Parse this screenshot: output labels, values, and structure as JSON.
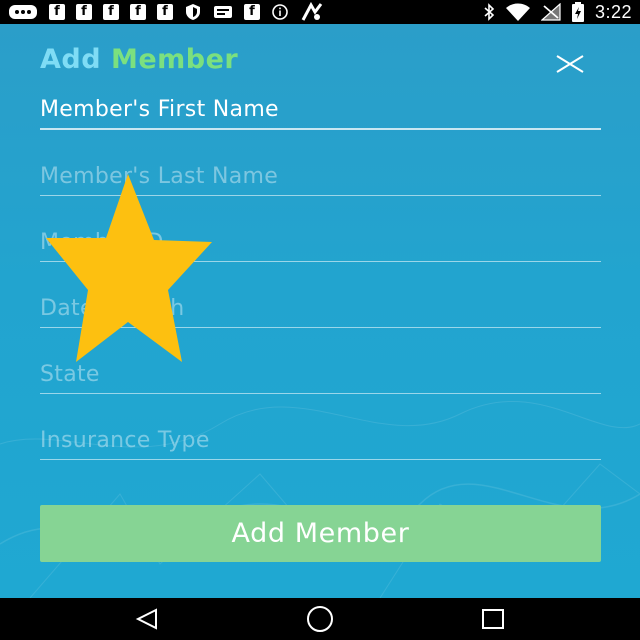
{
  "status_bar": {
    "time": "3:22",
    "left_icons": [
      "message-icon",
      "facebook-icon",
      "facebook-icon",
      "facebook-icon",
      "facebook-icon",
      "facebook-icon",
      "shield-icon",
      "email-icon",
      "facebook-icon",
      "info-icon",
      "fake-gps-icon"
    ],
    "facebook_glyph": "f",
    "right_icons": [
      "bluetooth-icon",
      "wifi-icon",
      "signal-icon",
      "battery-icon"
    ]
  },
  "dialog": {
    "title_part1": "Add",
    "title_part2": "Member",
    "title_part1_color": "#7fdcf5",
    "title_part2_color": "#7be07f",
    "close_icon": "close-icon"
  },
  "form": {
    "first_name": {
      "value": "Member's First Name",
      "placeholder": "Member's First Name"
    },
    "last_name": {
      "value": "",
      "placeholder": "Member's Last Name"
    },
    "member_id": {
      "value": "",
      "placeholder": "Member ID"
    },
    "dob": {
      "value": "",
      "placeholder": "Date of Birth"
    },
    "state": {
      "value": "",
      "placeholder": "State"
    },
    "insurance_type": {
      "value": "",
      "placeholder": "Insurance Type"
    }
  },
  "add_button": {
    "label": "Add Member",
    "color": "#86d494"
  },
  "overlay": {
    "icon": "star-icon",
    "color": "#fdc010"
  },
  "nav_bar": {
    "icons": [
      "back-icon",
      "home-icon",
      "recents-icon"
    ]
  }
}
